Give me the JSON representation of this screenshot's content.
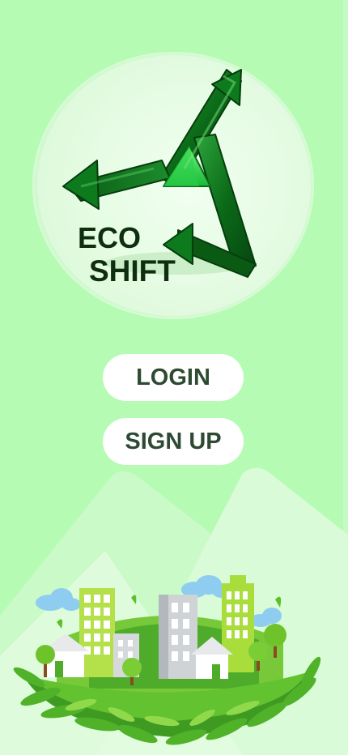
{
  "brand": {
    "line1": "ECO",
    "line2": "SHIFT",
    "icon": "recycle-triangle-arrows-icon"
  },
  "auth": {
    "login_label": "LOGIN",
    "signup_label": "SIGN UP"
  },
  "illustration": {
    "name": "green-city-nest-illustration"
  },
  "colors": {
    "background": "#b6fbb4",
    "logo_green": "#0e6e1a",
    "button_bg": "#ffffff",
    "button_text": "#2e4a33",
    "logo_text": "#0f2e0f"
  }
}
